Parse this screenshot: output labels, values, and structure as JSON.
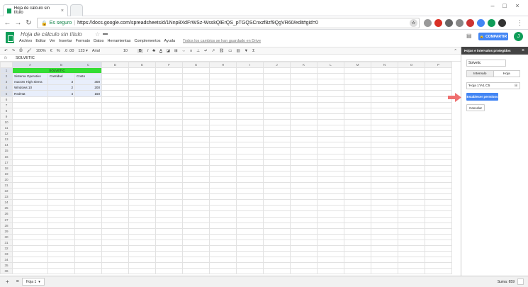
{
  "browser": {
    "tab_title": "Hoja de cálculo sin título",
    "security_label": "Es seguro",
    "url": "https://docs.google.com/spreadsheets/d/1Nnp8XdFrWSz-WsskQlErQS_pTGQSCnxzf8zf9QgVR60/edit#gid=0"
  },
  "docs": {
    "title": "Hoja de cálculo sin título",
    "menu": [
      "Archivo",
      "Editar",
      "Ver",
      "Insertar",
      "Formato",
      "Datos",
      "Herramientas",
      "Complementos",
      "Ayuda"
    ],
    "save_status": "Todos los cambios se han guardado en Drive",
    "share_label": "COMPARTIR",
    "avatar_letter": "J"
  },
  "toolbar": {
    "zoom": "100%",
    "currency": "€",
    "percent": "%",
    "decimals": ".0  .00",
    "number_format": "123 ▾",
    "font": "Arial",
    "font_size": "10",
    "bold": "B",
    "italic": "I",
    "strike": "S",
    "text_color": "A",
    "sum": "Σ"
  },
  "formula_bar": {
    "fx": "fx",
    "value": "SOLVETIC"
  },
  "sheet": {
    "columns": [
      "A",
      "B",
      "C",
      "D",
      "E",
      "F",
      "G",
      "H",
      "I",
      "J",
      "K",
      "L",
      "M",
      "N",
      "O",
      "P"
    ],
    "row_count": 36,
    "title_cell": "SOLVETIC",
    "headers": [
      "Sistema Operativo",
      "Cantidad",
      "Costo"
    ],
    "rows": [
      [
        "macOS High Sierra",
        "3",
        "300"
      ],
      [
        "Windows 10",
        "2",
        "200"
      ],
      [
        "RedHat",
        "4",
        "150"
      ]
    ]
  },
  "sidebar": {
    "title": "Hojas e intervalos protegidos",
    "description": "Solvetic",
    "tab_range": "Intervalo",
    "tab_sheet": "Hoja",
    "range_value": "'Hoja 1'!A1:C5",
    "set_permissions": "Establecer permisos",
    "cancel": "Cancelar"
  },
  "sheet_tabs": {
    "add": "+",
    "list": "≡",
    "active_tab": "Hoja 1",
    "sum_status": "Suma: 659"
  },
  "colors": {
    "accent": "#4285f4",
    "green": "#33dd33",
    "brand": "#0f9d58",
    "arrow": "#ef6f6f"
  }
}
